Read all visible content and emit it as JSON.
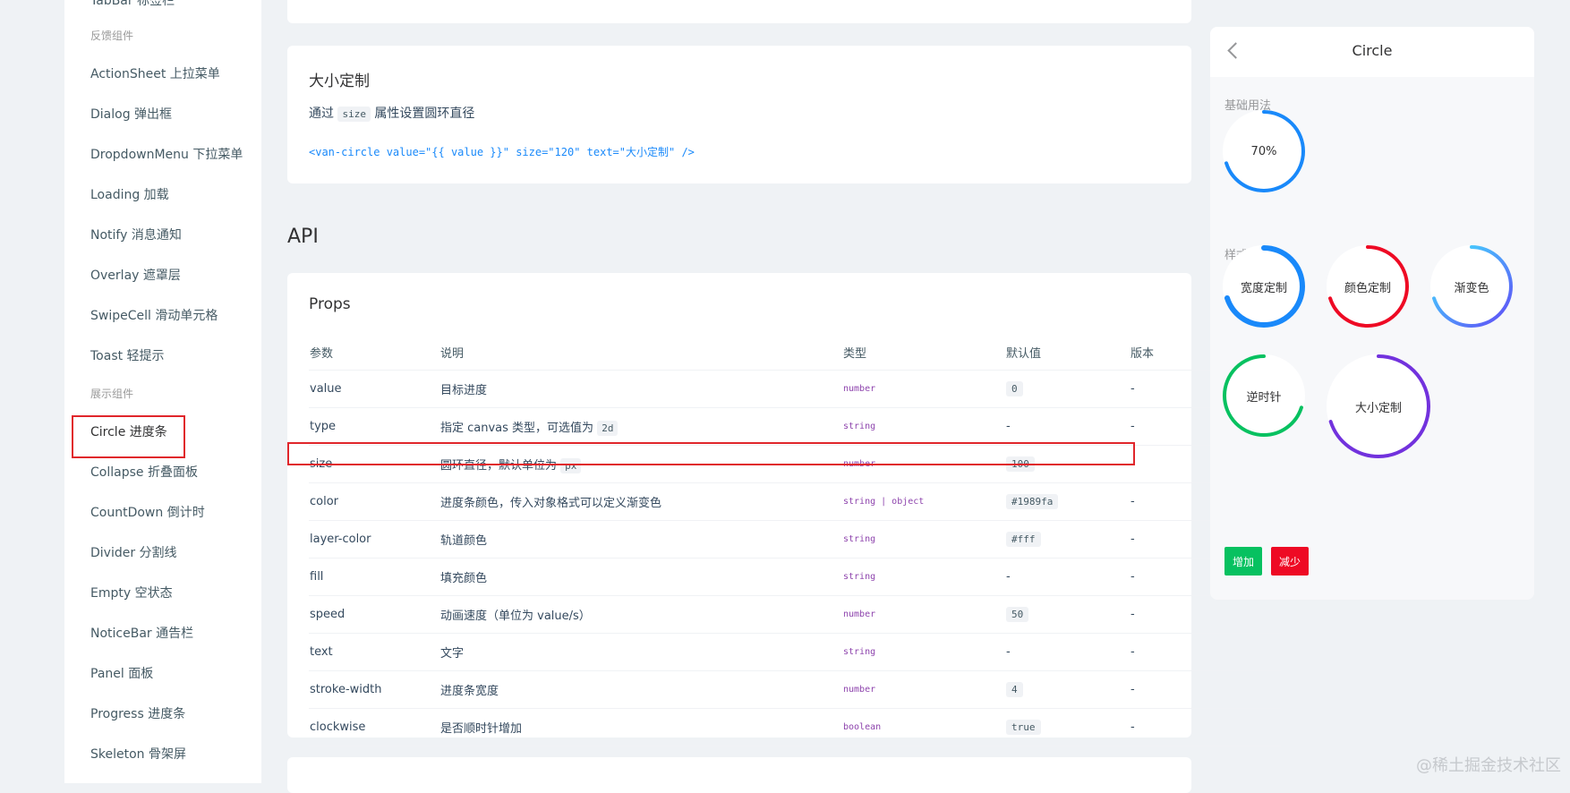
{
  "sidebar": {
    "top_cut_text": "TabBar 标签栏",
    "groups": {
      "feedback": "反馈组件",
      "display": "展示组件"
    },
    "feedback_items": [
      "ActionSheet 上拉菜单",
      "Dialog 弹出框",
      "DropdownMenu 下拉菜单",
      "Loading 加载",
      "Notify 消息通知",
      "Overlay 遮罩层",
      "SwipeCell 滑动单元格",
      "Toast 轻提示"
    ],
    "display_items": [
      "Circle 进度条",
      "Collapse 折叠面板",
      "CountDown 倒计时",
      "Divider 分割线",
      "Empty 空状态",
      "NoticeBar 通告栏",
      "Panel 面板",
      "Progress 进度条",
      "Skeleton 骨架屏"
    ]
  },
  "size_card": {
    "title": "大小定制",
    "desc_before": "通过",
    "desc_code": "size",
    "desc_after": "属性设置圆环直径",
    "code": "<van-circle value=\"{{ value }}\" size=\"120\" text=\"大小定制\" />"
  },
  "api": {
    "title": "API",
    "props_title": "Props",
    "headers": [
      "参数",
      "说明",
      "类型",
      "默认值",
      "版本"
    ],
    "rows": [
      {
        "name": "value",
        "desc": "目标进度",
        "desc_code": "",
        "type": "number",
        "default": "0",
        "default_code": true,
        "version": "-"
      },
      {
        "name": "type",
        "desc": "指定 canvas 类型，可选值为",
        "desc_code": "2d",
        "type": "string",
        "default": "-",
        "default_code": false,
        "version": "-"
      },
      {
        "name": "size",
        "desc": "圆环直径，默认单位为",
        "desc_code": "px",
        "type": "number",
        "default": "100",
        "default_code": true,
        "version": "-"
      },
      {
        "name": "color",
        "desc": "进度条颜色，传入对象格式可以定义渐变色",
        "desc_code": "",
        "type": "string | object",
        "default": "#1989fa",
        "default_code": true,
        "version": "-"
      },
      {
        "name": "layer-color",
        "desc": "轨道颜色",
        "desc_code": "",
        "type": "string",
        "default": "#fff",
        "default_code": true,
        "version": "-"
      },
      {
        "name": "fill",
        "desc": "填充颜色",
        "desc_code": "",
        "type": "string",
        "default": "-",
        "default_code": false,
        "version": "-"
      },
      {
        "name": "speed",
        "desc": "动画速度（单位为 value/s）",
        "desc_code": "",
        "type": "number",
        "default": "50",
        "default_code": true,
        "version": "-"
      },
      {
        "name": "text",
        "desc": "文字",
        "desc_code": "",
        "type": "string",
        "default": "-",
        "default_code": false,
        "version": "-"
      },
      {
        "name": "stroke-width",
        "desc": "进度条宽度",
        "desc_code": "",
        "type": "number",
        "default": "4",
        "default_code": true,
        "version": "-"
      },
      {
        "name": "clockwise",
        "desc": "是否顺时针增加",
        "desc_code": "",
        "type": "boolean",
        "default": "true",
        "default_code": true,
        "version": "-"
      }
    ]
  },
  "preview": {
    "nav_title": "Circle",
    "back_icon": "chevron-left-icon",
    "groups": {
      "basic": "基础用法",
      "custom": "样式定制"
    },
    "circles": [
      {
        "key": "basic",
        "text": "70%",
        "progress": 0.7,
        "color": "#1989fa",
        "counter": false
      },
      {
        "key": "width",
        "text": "宽度定制",
        "progress": 0.7,
        "color": "#1989fa",
        "counter": false
      },
      {
        "key": "color",
        "text": "颜色定制",
        "progress": 0.7,
        "color": "#ee0a24",
        "counter": false
      },
      {
        "key": "gradient",
        "text": "渐变色",
        "progress": 0.7,
        "color": "#4fc6f5",
        "counter": false
      },
      {
        "key": "counter",
        "text": "逆时针",
        "progress": 0.7,
        "color": "#07c160",
        "counter": true
      },
      {
        "key": "size",
        "text": "大小定制",
        "progress": 0.7,
        "color": "#7232dd",
        "counter": false
      }
    ],
    "increase_label": "增加",
    "decrease_label": "减少",
    "colors": {
      "green": "#07c160",
      "red": "#ee0a24"
    }
  },
  "watermark": "@稀土掘金技术社区"
}
